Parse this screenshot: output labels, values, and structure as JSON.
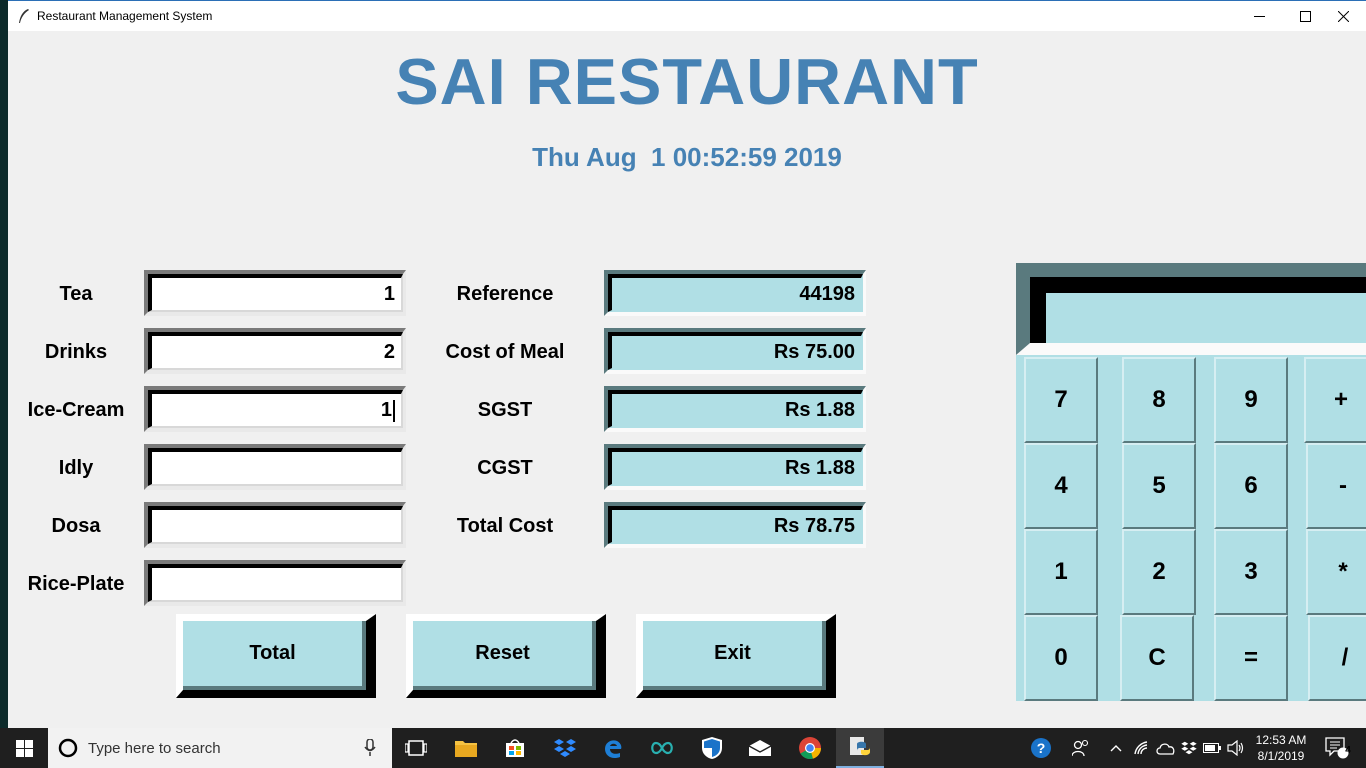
{
  "window": {
    "title": "Restaurant Management System",
    "controls": [
      "minimize-icon",
      "maximize-icon",
      "close-icon"
    ]
  },
  "heading": "SAI RESTAURANT",
  "datetime": "Thu Aug  1 00:52:59 2019",
  "items": [
    {
      "label": "Tea",
      "value": "1"
    },
    {
      "label": "Drinks",
      "value": "2"
    },
    {
      "label": "Ice-Cream",
      "value": "1"
    },
    {
      "label": "Idly",
      "value": ""
    },
    {
      "label": "Dosa",
      "value": ""
    },
    {
      "label": "Rice-Plate",
      "value": ""
    }
  ],
  "summary": [
    {
      "label": "Reference",
      "value": "44198"
    },
    {
      "label": "Cost of Meal",
      "value": "Rs 75.00"
    },
    {
      "label": "SGST",
      "value": "Rs 1.88"
    },
    {
      "label": "CGST",
      "value": "Rs 1.88"
    },
    {
      "label": "Total Cost",
      "value": "Rs 78.75"
    }
  ],
  "actions": {
    "total": "Total",
    "reset": "Reset",
    "exit": "Exit"
  },
  "calculator": {
    "display": "",
    "keys": [
      "7",
      "8",
      "9",
      "+",
      "4",
      "5",
      "6",
      "-",
      "1",
      "2",
      "3",
      "*",
      "0",
      "C",
      "=",
      "/"
    ]
  },
  "colors": {
    "heading": "#4682b4",
    "entry_blue": "#b0dfe5",
    "taskbar": "#1f1f1f"
  },
  "taskbar": {
    "search_placeholder": "Type here to search",
    "apps": [
      "task-view-icon",
      "file-explorer-icon",
      "store-icon",
      "dropbox-icon",
      "edge-icon",
      "arduino-icon",
      "shield-icon",
      "mail-icon",
      "chrome-icon",
      "python-icon"
    ],
    "time": "12:53 AM",
    "date": "8/1/2019",
    "notification_count": "4"
  }
}
